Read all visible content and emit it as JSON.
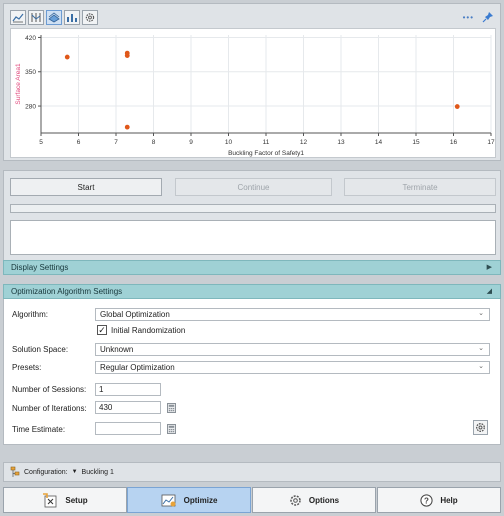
{
  "toolbar": {
    "icons": [
      "line-chart-icon",
      "parallel-plot-icon",
      "surface-plot-icon",
      "bar-chart-icon",
      "settings-icon"
    ],
    "more_label": "•••"
  },
  "chart_data": {
    "type": "scatter",
    "xlabel": "Buckling Factor of Safety1",
    "ylabel": "Surface Area1",
    "xlim": [
      5,
      17
    ],
    "ylim": [
      225,
      425
    ],
    "xticks": [
      5,
      6,
      7,
      8,
      9,
      10,
      11,
      12,
      13,
      14,
      15,
      16,
      17
    ],
    "yticks": [
      280,
      350,
      420
    ],
    "grid": true,
    "point_color": "#e0581a",
    "points": [
      {
        "x": 5.7,
        "y": 380
      },
      {
        "x": 7.3,
        "y": 388
      },
      {
        "x": 7.3,
        "y": 383
      },
      {
        "x": 7.3,
        "y": 237
      },
      {
        "x": 16.1,
        "y": 279
      }
    ]
  },
  "controls": {
    "start": "Start",
    "continue": "Continue",
    "terminate": "Terminate"
  },
  "display_settings": {
    "title": "Display Settings"
  },
  "algorithm_settings": {
    "title": "Optimization Algorithm Settings",
    "algorithm_label": "Algorithm:",
    "algorithm_value": "Global Optimization",
    "initial_randomization_label": "Initial Randomization",
    "initial_randomization_checked": true,
    "solution_space_label": "Solution Space:",
    "solution_space_value": "Unknown",
    "presets_label": "Presets:",
    "presets_value": "Regular Optimization",
    "sessions_label": "Number of Sessions:",
    "sessions_value": "1",
    "iterations_label": "Number of Iterations:",
    "iterations_value": "430",
    "time_label": "Time Estimate:",
    "time_value": ""
  },
  "configuration": {
    "label": "Configuration:",
    "value": "Buckling 1"
  },
  "nav": {
    "setup": "Setup",
    "optimize": "Optimize",
    "options": "Options",
    "help": "Help"
  },
  "colors": {
    "accent_header": "#9fd1d5",
    "active_button": "#b7d3f1",
    "axis_label_y": "#e0457a"
  }
}
